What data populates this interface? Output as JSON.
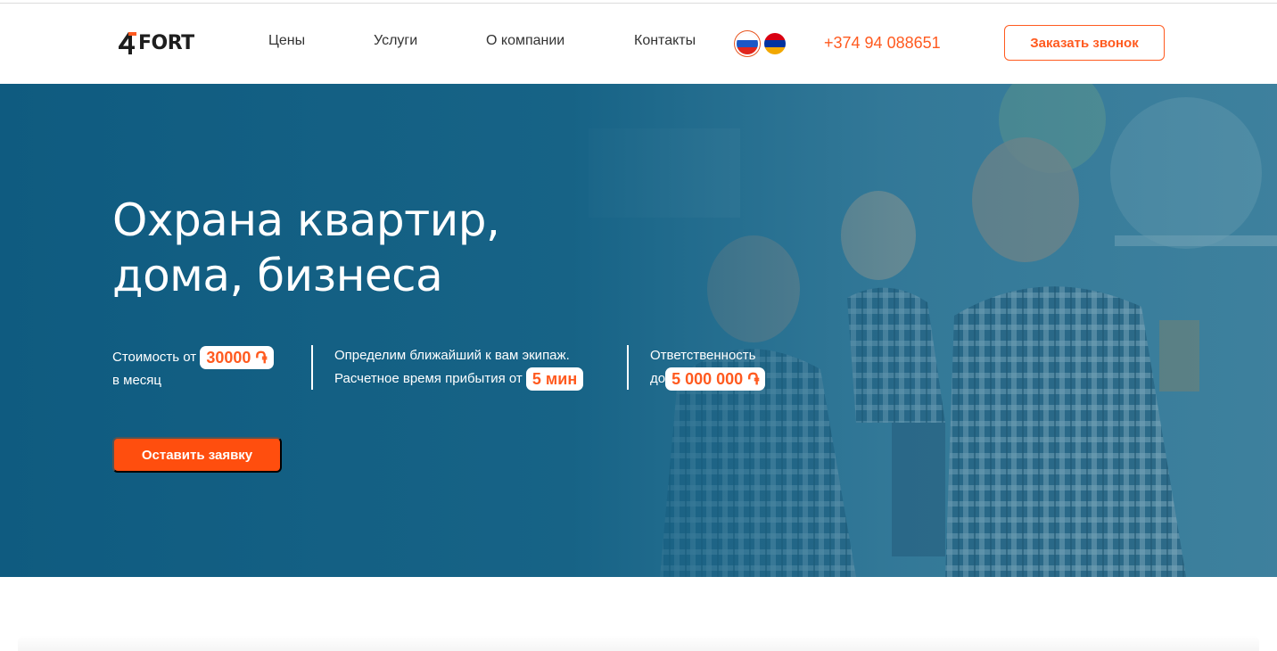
{
  "header": {
    "logo": {
      "mark": "4",
      "text": "FORT"
    },
    "nav": [
      {
        "label": "Цены"
      },
      {
        "label": "Услуги"
      },
      {
        "label": "О компании"
      },
      {
        "label": "Контакты"
      }
    ],
    "languages": [
      {
        "icon": "russia-flag-icon",
        "active": true
      },
      {
        "icon": "armenia-flag-icon",
        "active": false
      }
    ],
    "phone": "+374 94 088651",
    "callback_button": "Заказать звонок"
  },
  "hero": {
    "title_line1": "Охрана квартир,",
    "title_line2": "дома, бизнеса",
    "stats": [
      {
        "prefix": "Стоимость от",
        "value": "30000 ֏",
        "suffix": "в месяц"
      },
      {
        "line1": "Определим ближайший к вам экипаж.",
        "prefix": "Расчетное время прибытия от",
        "value": "5 мин"
      },
      {
        "line1": "Ответственность",
        "prefix": "до",
        "value": "5 000 000 ֏"
      }
    ],
    "cta_button": "Оставить заявку"
  },
  "colors": {
    "accent": "#ff5a1f",
    "hero_overlay": "#136589",
    "text_dark": "#333333"
  }
}
